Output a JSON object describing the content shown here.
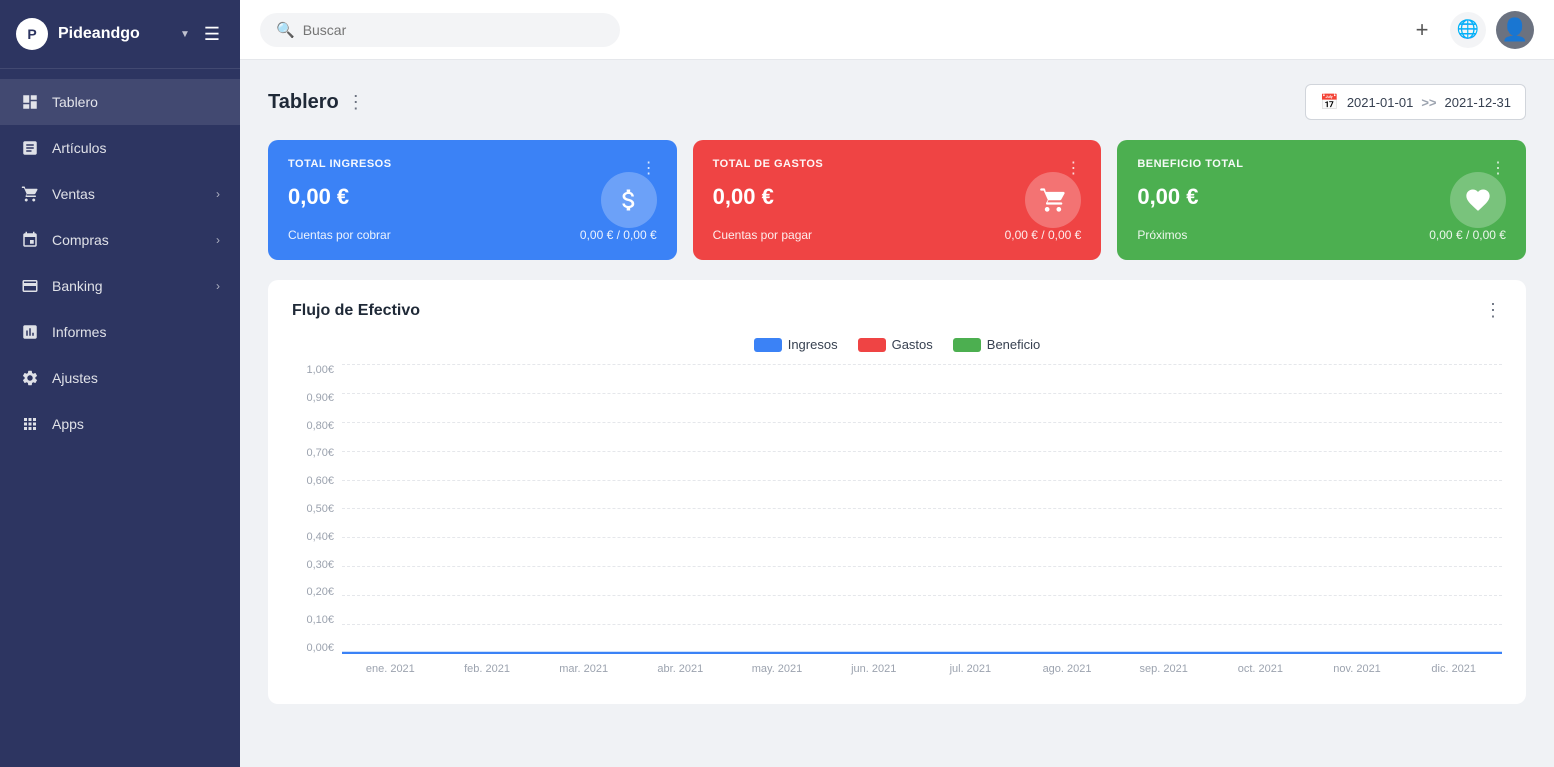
{
  "sidebar": {
    "brand": "Pideandgo",
    "brand_arrow": "▼",
    "logo_text": "P",
    "items": [
      {
        "id": "tablero",
        "label": "Tablero",
        "icon": "dashboard",
        "has_arrow": false,
        "active": true
      },
      {
        "id": "articulos",
        "label": "Artículos",
        "icon": "articles",
        "has_arrow": false,
        "active": false
      },
      {
        "id": "ventas",
        "label": "Ventas",
        "icon": "sales",
        "has_arrow": true,
        "active": false
      },
      {
        "id": "compras",
        "label": "Compras",
        "icon": "purchases",
        "has_arrow": true,
        "active": false
      },
      {
        "id": "banking",
        "label": "Banking",
        "icon": "banking",
        "has_arrow": true,
        "active": false
      },
      {
        "id": "informes",
        "label": "Informes",
        "icon": "reports",
        "has_arrow": false,
        "active": false
      },
      {
        "id": "ajustes",
        "label": "Ajustes",
        "icon": "settings",
        "has_arrow": false,
        "active": false
      },
      {
        "id": "apps",
        "label": "Apps",
        "icon": "apps",
        "has_arrow": false,
        "active": false
      }
    ]
  },
  "topbar": {
    "search_placeholder": "Buscar",
    "add_label": "+",
    "globe_label": "🌐"
  },
  "page": {
    "title": "Tablero",
    "date_from": "2021-01-01",
    "date_to": "2021-12-31",
    "date_separator": ">>"
  },
  "cards": [
    {
      "id": "ingresos",
      "title": "TOTAL INGRESOS",
      "amount": "0,00 €",
      "footer_label": "Cuentas por cobrar",
      "footer_value": "0,00 € / 0,00 €",
      "color": "blue",
      "icon": "💵"
    },
    {
      "id": "gastos",
      "title": "TOTAL DE GASTOS",
      "amount": "0,00 €",
      "footer_label": "Cuentas por pagar",
      "footer_value": "0,00 € / 0,00 €",
      "color": "red",
      "icon": "🛒"
    },
    {
      "id": "beneficio",
      "title": "BENEFICIO TOTAL",
      "amount": "0,00 €",
      "footer_label": "Próximos",
      "footer_value": "0,00 € / 0,00 €",
      "color": "green",
      "icon": "❤"
    }
  ],
  "chart": {
    "title": "Flujo de Efectivo",
    "legend": [
      {
        "label": "Ingresos",
        "color": "#3b82f6"
      },
      {
        "label": "Gastos",
        "color": "#ef4444"
      },
      {
        "label": "Beneficio",
        "color": "#4caf50"
      }
    ],
    "y_labels": [
      "0,00€",
      "0,10€",
      "0,20€",
      "0,30€",
      "0,40€",
      "0,50€",
      "0,60€",
      "0,70€",
      "0,80€",
      "0,90€",
      "1,00€"
    ],
    "x_labels": [
      "ene. 2021",
      "feb. 2021",
      "mar. 2021",
      "abr. 2021",
      "may. 2021",
      "jun. 2021",
      "jul. 2021",
      "ago. 2021",
      "sep. 2021",
      "oct. 2021",
      "nov. 2021",
      "dic. 2021"
    ]
  }
}
